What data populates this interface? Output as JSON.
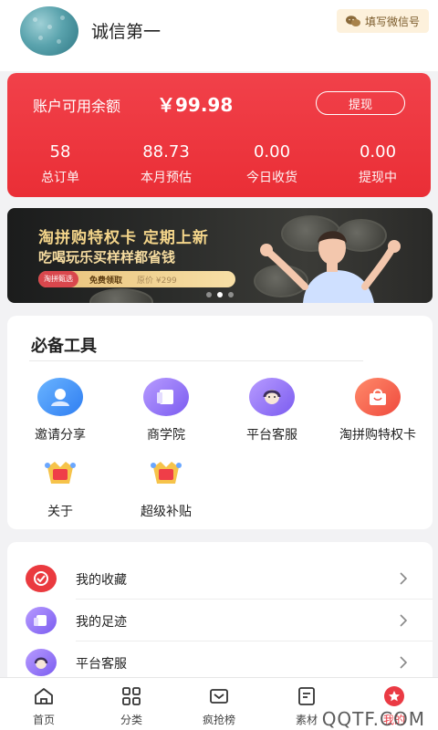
{
  "header": {
    "username": "诚信第一",
    "wechat_label": "填写微信号"
  },
  "balance": {
    "label": "账户可用余额",
    "amount": "￥99.98",
    "withdraw_label": "提现",
    "stats": [
      {
        "value": "58",
        "label": "总订单"
      },
      {
        "value": "88.73",
        "label": "本月预估"
      },
      {
        "value": "0.00",
        "label": "今日收货"
      },
      {
        "value": "0.00",
        "label": "提现中"
      }
    ]
  },
  "banner": {
    "title": "淘拼购特权卡 定期上新",
    "subtitle": "吃喝玩乐买样样都省钱",
    "pill_tag": "淘拼甄选",
    "pill_button": "免费领取",
    "pill_old_price": "原价 ¥299",
    "slide_count": 3,
    "active_slide": 2
  },
  "tools": {
    "title": "必备工具",
    "items": [
      {
        "label": "邀请分享",
        "icon": "invite-share-icon"
      },
      {
        "label": "商学院",
        "icon": "business-school-icon"
      },
      {
        "label": "平台客服",
        "icon": "customer-service-icon"
      },
      {
        "label": "淘拼购特权卡",
        "icon": "privilege-card-icon"
      },
      {
        "label": "关于",
        "icon": "about-icon"
      },
      {
        "label": "超级补贴",
        "icon": "super-subsidy-icon"
      }
    ]
  },
  "menu": {
    "items": [
      {
        "label": "我的收藏",
        "icon": "favorites-icon"
      },
      {
        "label": "我的足迹",
        "icon": "footprint-icon"
      },
      {
        "label": "平台客服",
        "icon": "customer-service-icon"
      }
    ]
  },
  "tabbar": {
    "items": [
      {
        "label": "首页",
        "icon": "home-icon"
      },
      {
        "label": "分类",
        "icon": "category-icon"
      },
      {
        "label": "疯抢榜",
        "icon": "ranking-icon"
      },
      {
        "label": "素材",
        "icon": "material-icon"
      },
      {
        "label": "我的",
        "icon": "profile-icon"
      }
    ],
    "active": "我的"
  },
  "watermark": "QQTF.COM",
  "colors": {
    "brand_red": "#ea2e36",
    "gold": "#f4d58a",
    "wechat_bg": "#fdf1dc"
  }
}
